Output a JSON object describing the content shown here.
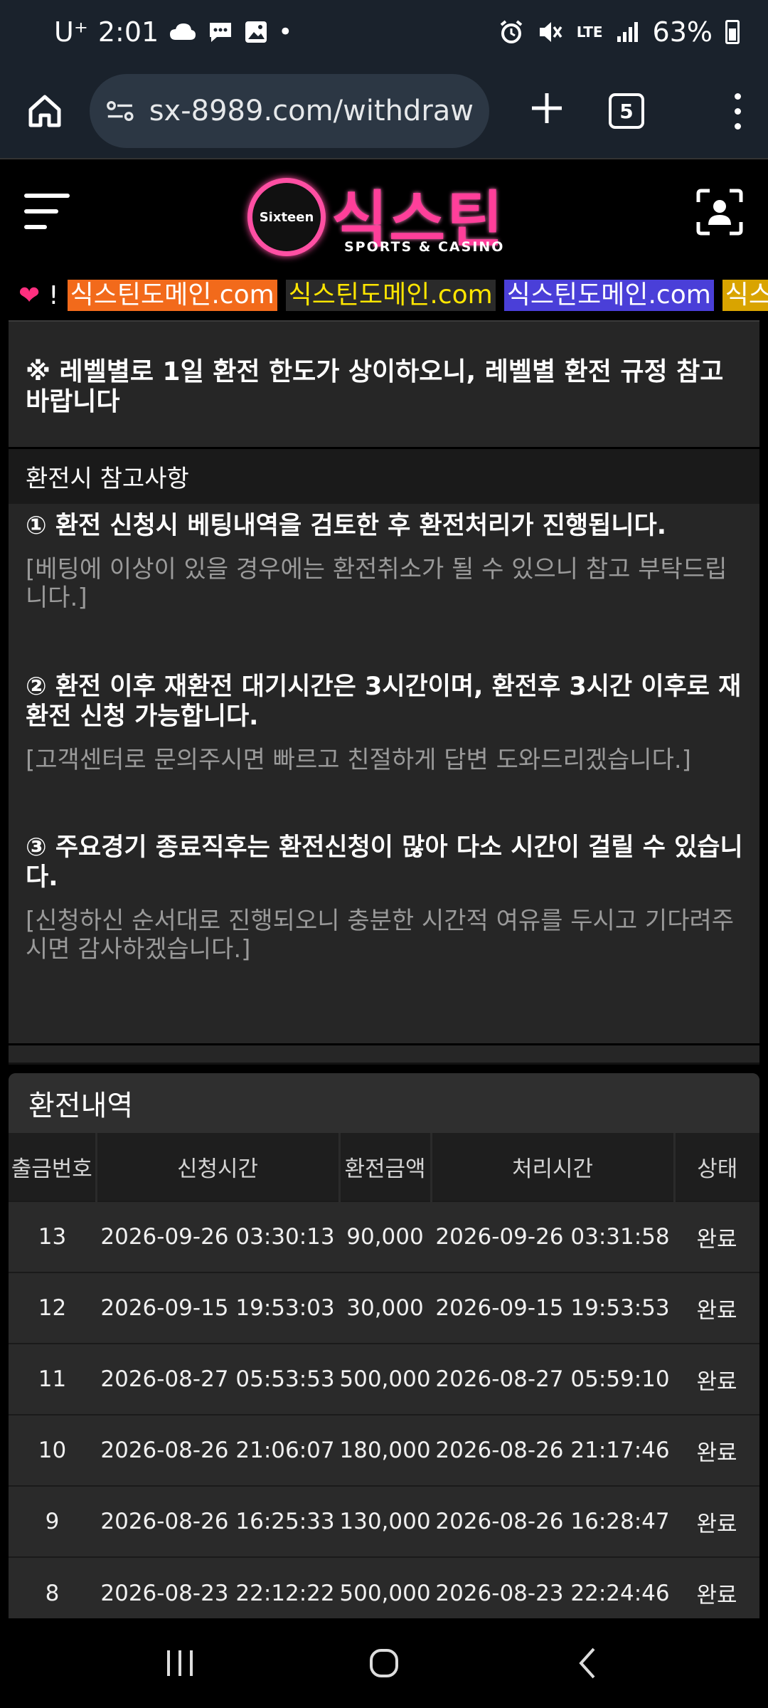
{
  "status_bar": {
    "carrier": "U⁺",
    "time": "2:01",
    "network": "LTE",
    "battery": "63%"
  },
  "browser": {
    "url": "sx-8989.com/withdraw",
    "tab_count": "5"
  },
  "site": {
    "logo_badge": "Sixteen",
    "logo_title": "식스틴",
    "logo_subtitle": "SPORTS & CASINO"
  },
  "marquee": {
    "prefix": "!",
    "items": [
      {
        "text": "식스틴도메인.com",
        "bg": "#f26a1b",
        "fg": "#ffffff"
      },
      {
        "text": "식스틴도메인.com",
        "bg": "#2a2a2a",
        "fg": "#ffe600"
      },
      {
        "text": "식스틴도메인.com",
        "bg": "#4a3fd8",
        "fg": "#ffffff"
      },
      {
        "text": "식스틴",
        "bg": "#d9a400",
        "fg": "#ffffff"
      }
    ]
  },
  "notice": {
    "limit_note": "※ 레벨별로 1일 환전 한도가 상이하오니, 레벨별 환전 규정 참고바랍니다",
    "section_title": "환전시 참고사항",
    "items": [
      {
        "title": "① 환전 신청시 베팅내역을 검토한 후 환전처리가 진행됩니다.",
        "sub": "[베팅에 이상이 있을 경우에는 환전취소가 될 수 있으니 참고 부탁드립니다.]"
      },
      {
        "title": "② 환전 이후 재환전 대기시간은 3시간이며, 환전후 3시간 이후로 재환전 신청 가능합니다.",
        "sub": "[고객센터로 문의주시면 빠르고 친절하게 답변 도와드리겠습니다.]"
      },
      {
        "title": "③ 주요경기 종료직후는 환전신청이 많아 다소 시간이 걸릴 수 있습니다.",
        "sub": "[신청하신 순서대로 진행되오니 충분한 시간적 여유를 두시고 기다려주시면 감사하겠습니다.]"
      }
    ]
  },
  "history": {
    "title": "환전내역",
    "columns": [
      "출금번호",
      "신청시간",
      "환전금액",
      "처리시간",
      "상태"
    ],
    "rows": [
      [
        "13",
        "2026-09-26 03:30:13",
        "90,000",
        "2026-09-26 03:31:58",
        "완료"
      ],
      [
        "12",
        "2026-09-15 19:53:03",
        "30,000",
        "2026-09-15 19:53:53",
        "완료"
      ],
      [
        "11",
        "2026-08-27 05:53:53",
        "500,000",
        "2026-08-27 05:59:10",
        "완료"
      ],
      [
        "10",
        "2026-08-26 21:06:07",
        "180,000",
        "2026-08-26 21:17:46",
        "완료"
      ],
      [
        "9",
        "2026-08-26 16:25:33",
        "130,000",
        "2026-08-26 16:28:47",
        "완료"
      ],
      [
        "8",
        "2026-08-23 22:12:22",
        "500,000",
        "2026-08-23 22:24:46",
        "완료"
      ]
    ]
  },
  "colors": {
    "brand_pink": "#ff3f9a",
    "panel_bg": "#262626",
    "muted_text": "#9a9a9a"
  }
}
